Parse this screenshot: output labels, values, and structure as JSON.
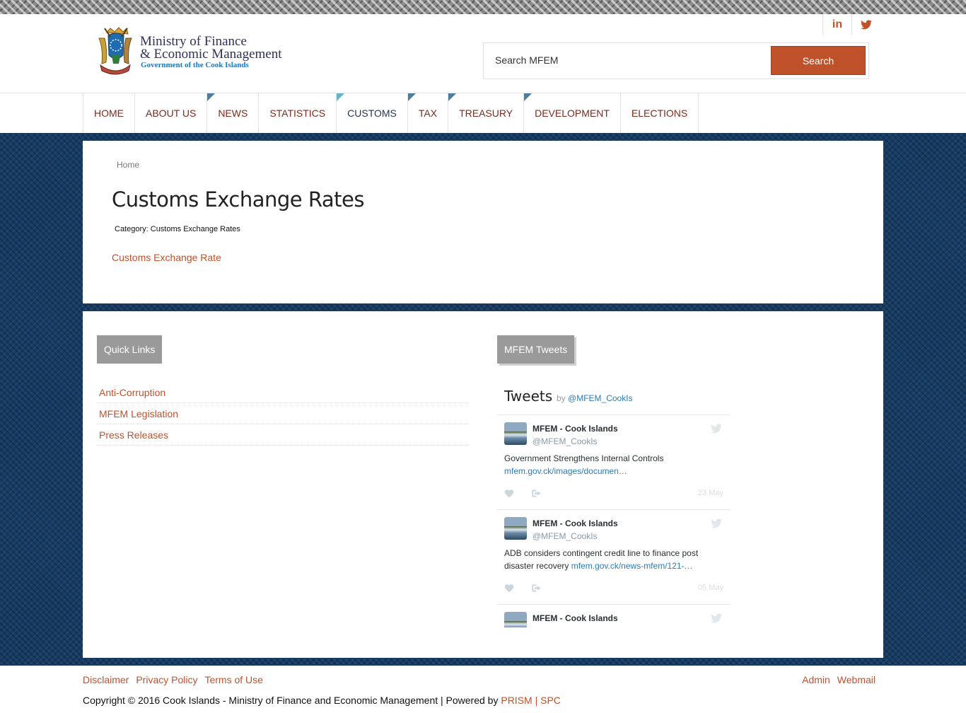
{
  "colors": {
    "accent": "#c0522b",
    "navy_bg": "#163c64",
    "nav_text": "#7a2b1e",
    "nav_corner": "#4d7e9e",
    "module_title_bg": "#9a9a9a"
  },
  "logo": {
    "line1": "Ministry of Finance",
    "line2": "& Economic Management",
    "line3": "Government of the Cook Islands",
    "icon": "cook-islands-coat-of-arms"
  },
  "social": {
    "linkedin_label": "in",
    "linkedin_icon": "linkedin-icon",
    "twitter_icon": "twitter-icon"
  },
  "search": {
    "placeholder": "Search MFEM",
    "button": "Search"
  },
  "nav": [
    {
      "label": "HOME",
      "corner": false,
      "active": false
    },
    {
      "label": "ABOUT US",
      "corner": false,
      "active": false
    },
    {
      "label": "NEWS",
      "corner": true,
      "active": false
    },
    {
      "label": "STATISTICS",
      "corner": false,
      "active": false
    },
    {
      "label": "CUSTOMS",
      "corner": true,
      "active": true
    },
    {
      "label": "TAX",
      "corner": true,
      "active": false
    },
    {
      "label": "TREASURY",
      "corner": true,
      "active": false
    },
    {
      "label": "DEVELOPMENT",
      "corner": true,
      "active": false
    },
    {
      "label": "ELECTIONS",
      "corner": false,
      "active": false
    }
  ],
  "breadcrumb": "Home",
  "page": {
    "title": "Customs Exchange Rates",
    "category": "Category: Customs Exchange Rates",
    "link": "Customs Exchange Rate"
  },
  "quick_links": {
    "title": "Quick Links",
    "items": [
      "Anti-Corruption",
      "MFEM Legislation",
      "Press Releases"
    ]
  },
  "tweets": {
    "title": "MFEM Tweets",
    "widget_title": "Tweets",
    "by": "by",
    "by_handle": "@MFEM_CookIs",
    "items": [
      {
        "name": "MFEM - Cook Islands",
        "handle": "@MFEM_CookIs",
        "text": "Government Strengthens Internal Controls",
        "link": "mfem.gov.ck/images/documen…",
        "date": "23 May"
      },
      {
        "name": "MFEM - Cook Islands",
        "handle": "@MFEM_CookIs",
        "text": "ADB considers contingent credit line to finance post disaster recovery",
        "link": "mfem.gov.ck/news-mfem/121-…",
        "date": "05 May"
      },
      {
        "name": "MFEM - Cook Islands",
        "handle": "@MFEM_CookIs",
        "text": "",
        "link": "",
        "date": ""
      }
    ]
  },
  "footer": {
    "links": [
      "Disclaimer",
      "Privacy Policy",
      "Terms of Use"
    ],
    "right_links": [
      "Admin",
      "Webmail"
    ],
    "copyright": "Copyright © 2016 Cook Islands - Ministry of Finance and Economic Management | Powered by ",
    "powered": "PRISM | SPC"
  }
}
